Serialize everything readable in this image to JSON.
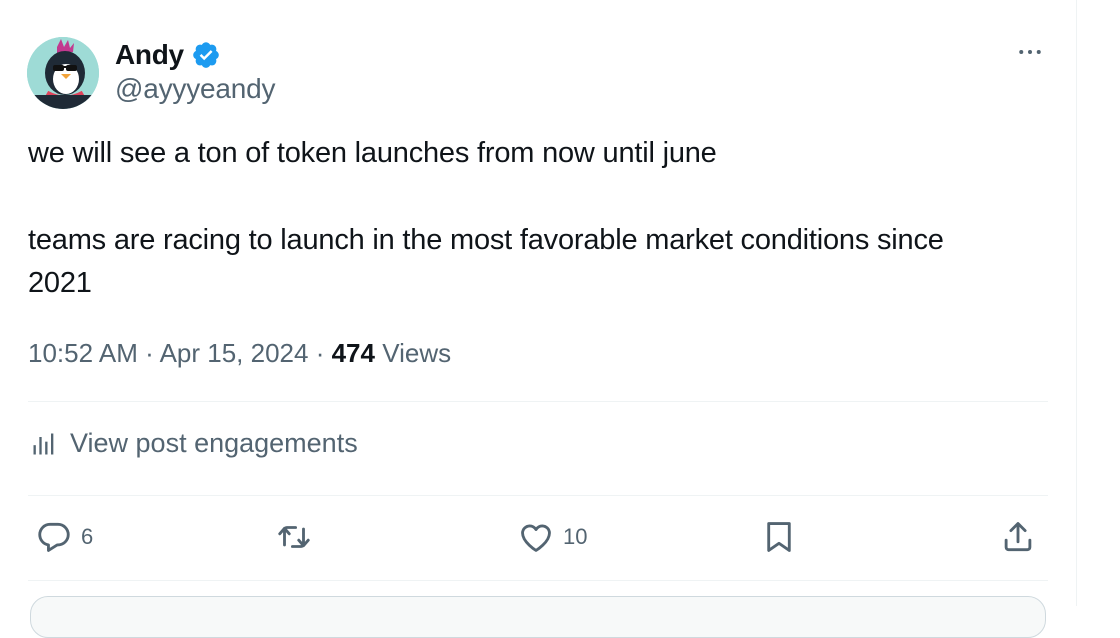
{
  "tweet": {
    "author": {
      "display_name": "Andy",
      "handle": "@ayyyeandy",
      "verified": true,
      "avatar_icon": "penguin-avatar-icon",
      "avatar_bg": "#9edbd6"
    },
    "text_lines": [
      "we will see a ton of token launches from now until june",
      "teams are racing to launch in the most favorable market conditions since",
      "2021"
    ],
    "meta": {
      "time": "10:52 AM",
      "sep1": "·",
      "date": "Apr 15, 2024",
      "sep2": "·",
      "views_count": "474",
      "views_label": "Views"
    },
    "engagements_label": "View post engagements",
    "actions": {
      "reply_count": "6",
      "repost_count": "",
      "like_count": "10"
    }
  },
  "colors": {
    "accent": "#1d9bf0",
    "text_primary": "#0f1419",
    "text_secondary": "#536471",
    "divider": "#eff3f4"
  },
  "icons": {
    "more": "more-dots-icon",
    "verified": "verified-badge-icon",
    "engagements": "bar-chart-icon",
    "reply": "reply-bubble-icon",
    "repost": "repost-icon",
    "like": "heart-icon",
    "bookmark": "bookmark-icon",
    "share": "share-icon"
  }
}
